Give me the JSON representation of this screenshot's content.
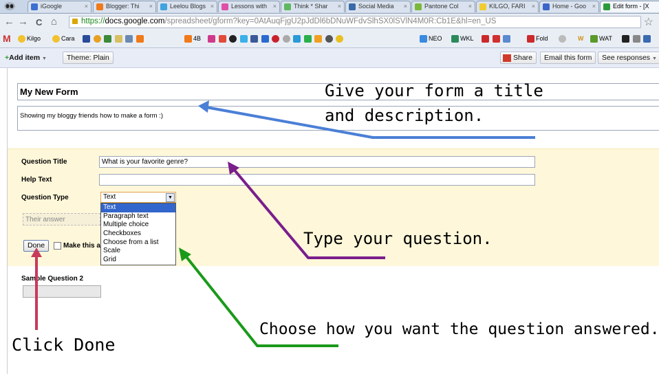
{
  "browser": {
    "tabs": [
      {
        "label": "iGoogle",
        "color": "#3b6fd1"
      },
      {
        "label": "Blogger: Thi",
        "color": "#f07a18"
      },
      {
        "label": "Leelou Blogs",
        "color": "#3fa3e0"
      },
      {
        "label": "Lessons with",
        "color": "#e04fa8"
      },
      {
        "label": "Think * Shar",
        "color": "#5fb85f"
      },
      {
        "label": "Social Media",
        "color": "#3a6aa8"
      },
      {
        "label": "Pantone Col",
        "color": "#7ab83a"
      },
      {
        "label": "KILGO, FARI",
        "color": "#f2cc2e"
      },
      {
        "label": "Home - Goo",
        "color": "#3a66c8"
      },
      {
        "label": "Edit form - [Х",
        "color": "#2c9a3a"
      }
    ],
    "tab_close": "×",
    "url_https": "https://",
    "url_host": "docs.google.com",
    "url_rest": "/spreadsheet/gform?key=0AtAuqFjgU2pJdDl6bDNuWFdvSlhSX0lSVlN4M0R:Cb1E&hl=en_US",
    "nav": {
      "back": "←",
      "forward": "→",
      "reload": "C",
      "home": "⌂"
    },
    "star": "☆",
    "bookmarks": [
      {
        "label": "Kilgo",
        "color": "#f2c22e"
      },
      {
        "label": "Cara",
        "color": "#f2c22e"
      },
      {
        "label": "4B",
        "color": "#f07a18"
      },
      {
        "label": "NEO",
        "color": "#3a8ae0"
      },
      {
        "label": "WKL",
        "color": "#2c8a5a"
      },
      {
        "label": "Fold",
        "color": "#cc2a2a"
      },
      {
        "label": "W",
        "color": "#e0a020"
      },
      {
        "label": "WAT",
        "color": "#5a9a2a"
      }
    ]
  },
  "toolbar": {
    "add_item": "Add item",
    "theme": "Theme:  Plain",
    "share": "Share",
    "email_form": "Email this form",
    "see_responses": "See responses"
  },
  "form": {
    "title": "My New Form",
    "description": "Showing my bloggy friends how to make a form :)"
  },
  "question": {
    "title_label": "Question Title",
    "title_value": "What is your favorite genre?",
    "help_label": "Help Text",
    "help_value": "",
    "type_label": "Question Type",
    "type_value": "Text",
    "type_options": [
      "Text",
      "Paragraph text",
      "Multiple choice",
      "Checkboxes",
      "Choose from a list",
      "Scale",
      "Grid"
    ],
    "answer_placeholder": "Their answer",
    "done": "Done",
    "required_label": "Make this a"
  },
  "sample_q2": "Sample Question 2",
  "annotations": {
    "title_note_1": "Give your form a title",
    "title_note_2": "and description.",
    "question_note": "Type your question.",
    "type_note": "Choose how you want the question answered.",
    "done_note": "Click Done"
  },
  "colors": {
    "arrow_blue": "#4a7fd6",
    "arrow_purple": "#7a1e8c",
    "arrow_green": "#1a9a1a",
    "arrow_red": "#c83a5a"
  }
}
